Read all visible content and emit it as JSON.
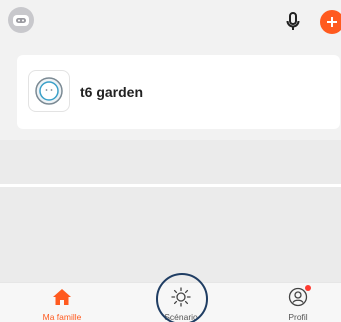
{
  "device": {
    "name": "t6 garden"
  },
  "tabs": [
    {
      "label": "Ma famille",
      "icon": "home-icon",
      "active": true
    },
    {
      "label": "Scénario",
      "icon": "sun-icon",
      "active": false
    },
    {
      "label": "Profil",
      "icon": "profile-icon",
      "active": false,
      "has_badge": true
    }
  ],
  "colors": {
    "accent": "#ff5a1f",
    "badge": "#ff3b30",
    "highlight_ring": "#1f3d63"
  }
}
